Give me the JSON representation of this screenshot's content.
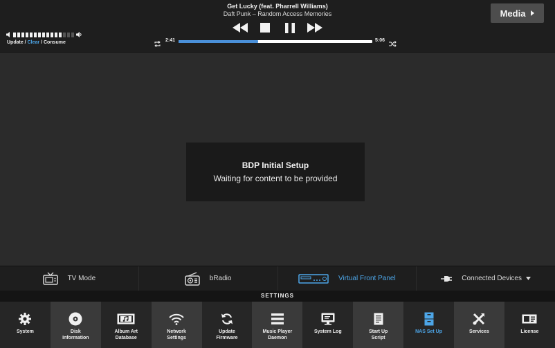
{
  "now_playing": {
    "title": "Get Lucky (feat. Pharrell Williams)",
    "subtitle": "Daft Punk – Random Access Memories"
  },
  "volume": {
    "level": 0.8
  },
  "queue_links": {
    "update": "Update",
    "clear": "Clear",
    "consume": "Consume",
    "separator": " / "
  },
  "progress": {
    "elapsed": "2:41",
    "total": "5:06",
    "fraction": 0.41
  },
  "media_button": {
    "label": "Media"
  },
  "setup_panel": {
    "title": "BDP Initial Setup",
    "message": "Waiting for content to be provided"
  },
  "modes": [
    {
      "label": "TV Mode",
      "icon": "tv-icon"
    },
    {
      "label": "bRadio",
      "icon": "radio-icon"
    },
    {
      "label": "Virtual Front Panel",
      "icon": "front-panel-icon",
      "active": true
    },
    {
      "label": "Connected Devices",
      "icon": "plug-icon"
    }
  ],
  "settings": {
    "title": "SETTINGS",
    "tiles": [
      {
        "label": "System",
        "icon": "gear-icon"
      },
      {
        "label": "Disk\nInformation",
        "icon": "disc-icon"
      },
      {
        "label": "Album Art\nDatabase",
        "icon": "album-art-icon"
      },
      {
        "label": "Network\nSettings",
        "icon": "wifi-icon"
      },
      {
        "label": "Update\nFirmware",
        "icon": "refresh-icon"
      },
      {
        "label": "Music Player\nDaemon",
        "icon": "list-icon"
      },
      {
        "label": "System Log",
        "icon": "monitor-icon"
      },
      {
        "label": "Start Up\nScript",
        "icon": "document-icon"
      },
      {
        "label": "NAS Set Up",
        "icon": "nas-icon",
        "active": true
      },
      {
        "label": "Services",
        "icon": "tools-icon"
      },
      {
        "label": "License",
        "icon": "license-icon"
      }
    ]
  },
  "colors": {
    "accent": "#4da6e8",
    "progress": "#4a90d9",
    "bar_bg": "#1e1e1e",
    "main_bg": "#2b2b2b"
  }
}
